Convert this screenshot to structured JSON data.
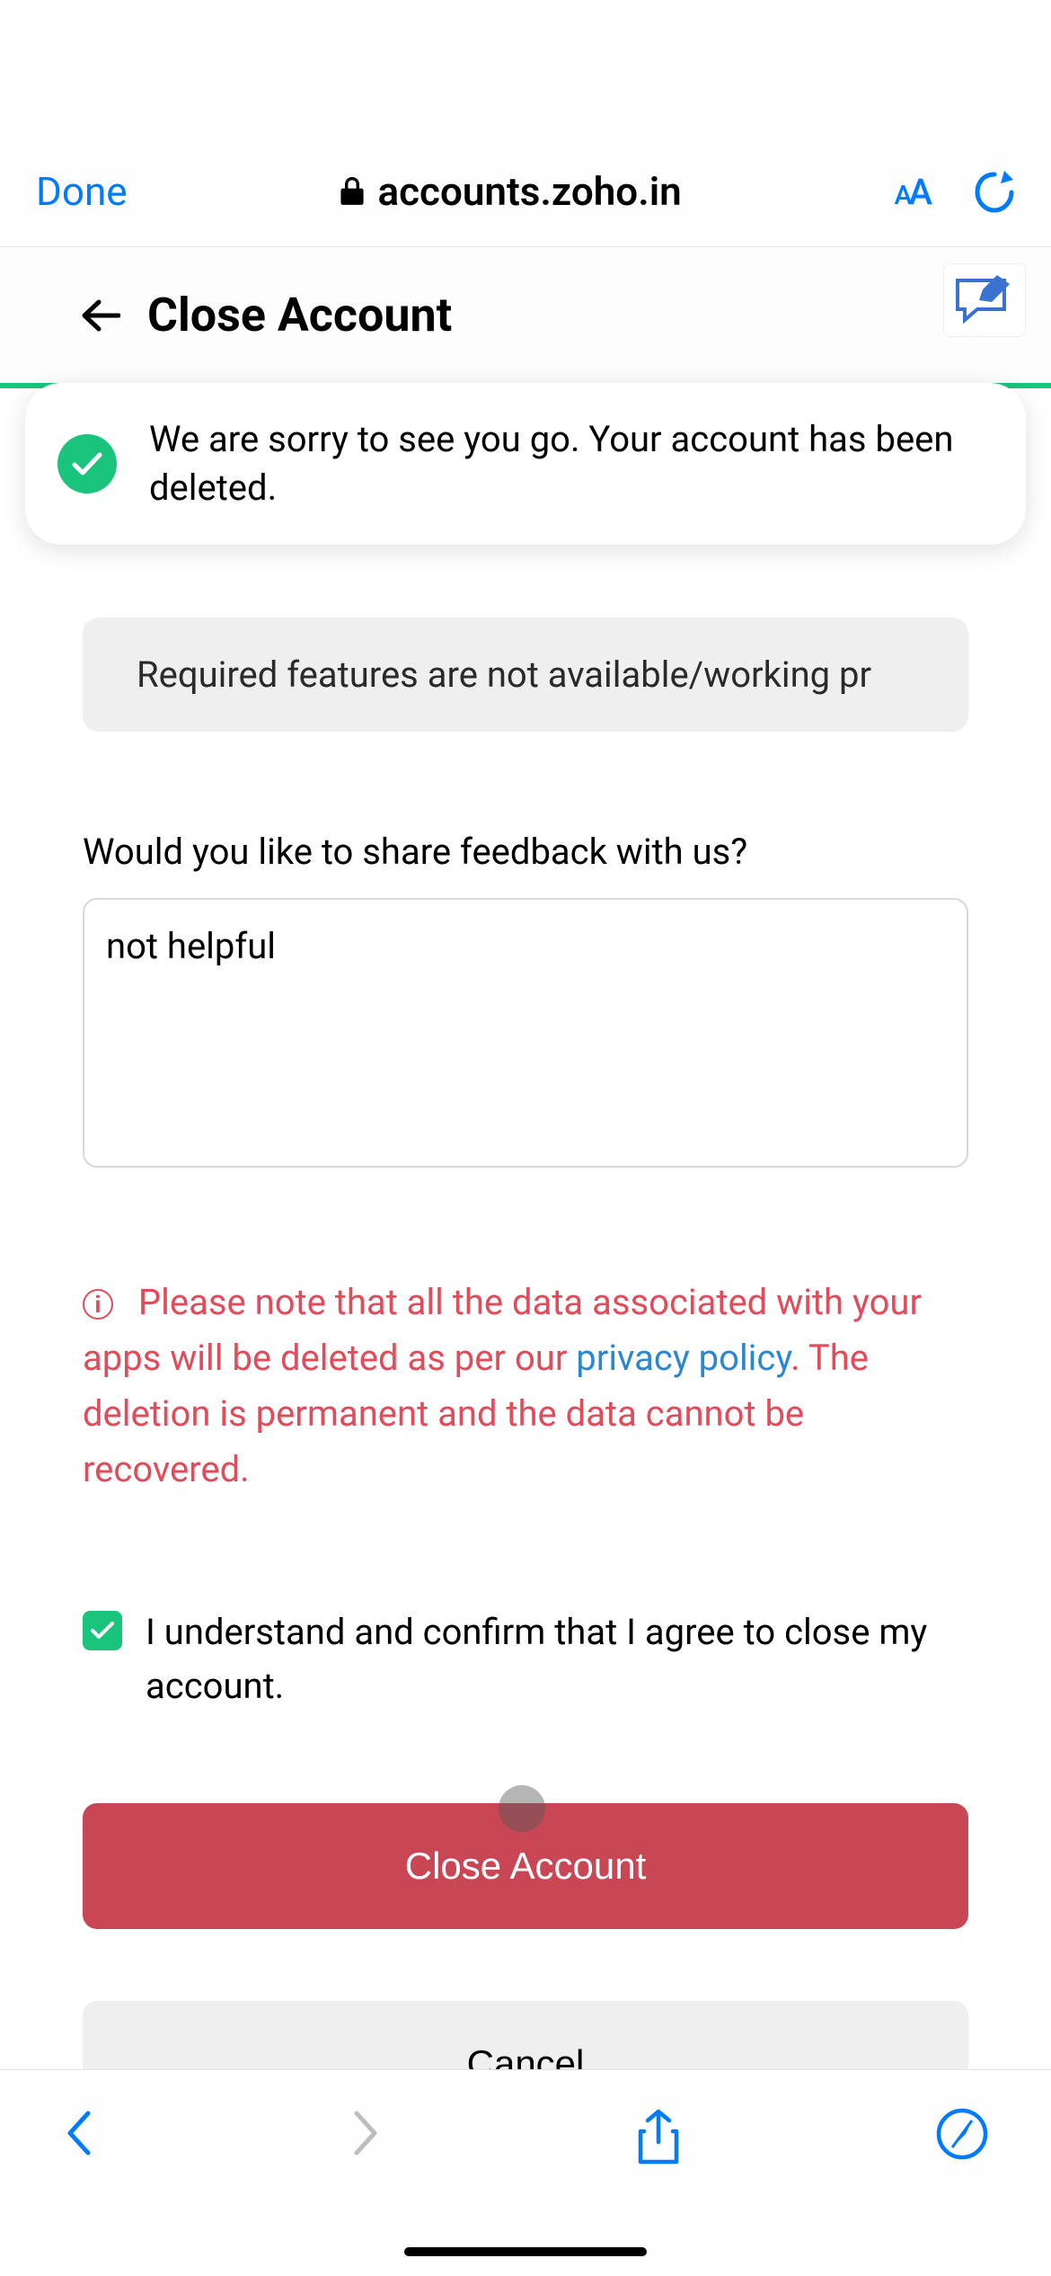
{
  "safari": {
    "done_label": "Done",
    "url": "accounts.zoho.in",
    "aa_label": "AA"
  },
  "header": {
    "title": "Close Account"
  },
  "toast": {
    "message": "We are sorry to see you go. Your account has been deleted."
  },
  "reason": {
    "selected": "Required features are not available/working pr"
  },
  "feedback": {
    "label": "Would you like to share feedback with us?",
    "value": "not helpful"
  },
  "warning": {
    "text_before": "Please note that all the data associated with your apps will be deleted as per our ",
    "link_text": "privacy policy",
    "text_after": ". The deletion is permanent and the data cannot be recovered."
  },
  "confirm": {
    "checked": true,
    "text": "I understand and confirm that I agree to close my account."
  },
  "buttons": {
    "close": "Close Account",
    "cancel": "Cancel"
  }
}
